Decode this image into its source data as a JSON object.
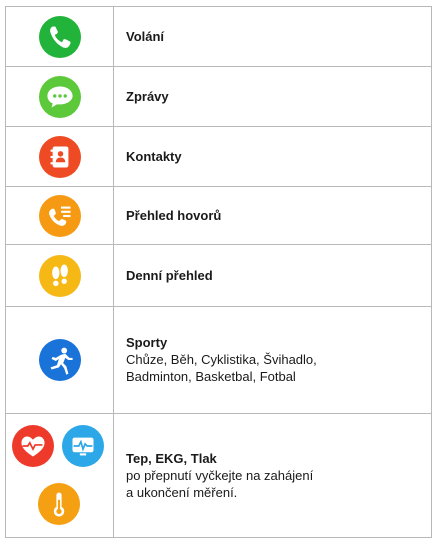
{
  "rows": [
    {
      "title": "Volání",
      "icon": "phone-icon",
      "color": "#22b33a"
    },
    {
      "title": "Zprávy",
      "icon": "chat-bubble-icon",
      "color": "#5cc93a"
    },
    {
      "title": "Kontakty",
      "icon": "contacts-book-icon",
      "color": "#ee4a24"
    },
    {
      "title": "Přehled hovorů",
      "icon": "call-log-icon",
      "color": "#f59a12"
    },
    {
      "title": "Denní přehled",
      "icon": "footprints-icon",
      "color": "#f5b814"
    },
    {
      "title": "Sporty",
      "desc_lines": [
        "Chůze, Běh, Cyklistika, Švihadlo,",
        "Badminton, Basketbal, Fotbal"
      ],
      "icon": "running-man-icon",
      "color": "#1a73d9"
    },
    {
      "title": "Tep, EKG, Tlak",
      "desc_lines": [
        "po přepnutí vyčkejte na zahájení",
        "a ukončení měření."
      ],
      "icons": [
        "heart-rate-icon",
        "ecg-icon",
        "thermometer-icon"
      ],
      "colors": [
        "#ee3a2a",
        "#2ca7e8",
        "#f5a012"
      ]
    }
  ]
}
